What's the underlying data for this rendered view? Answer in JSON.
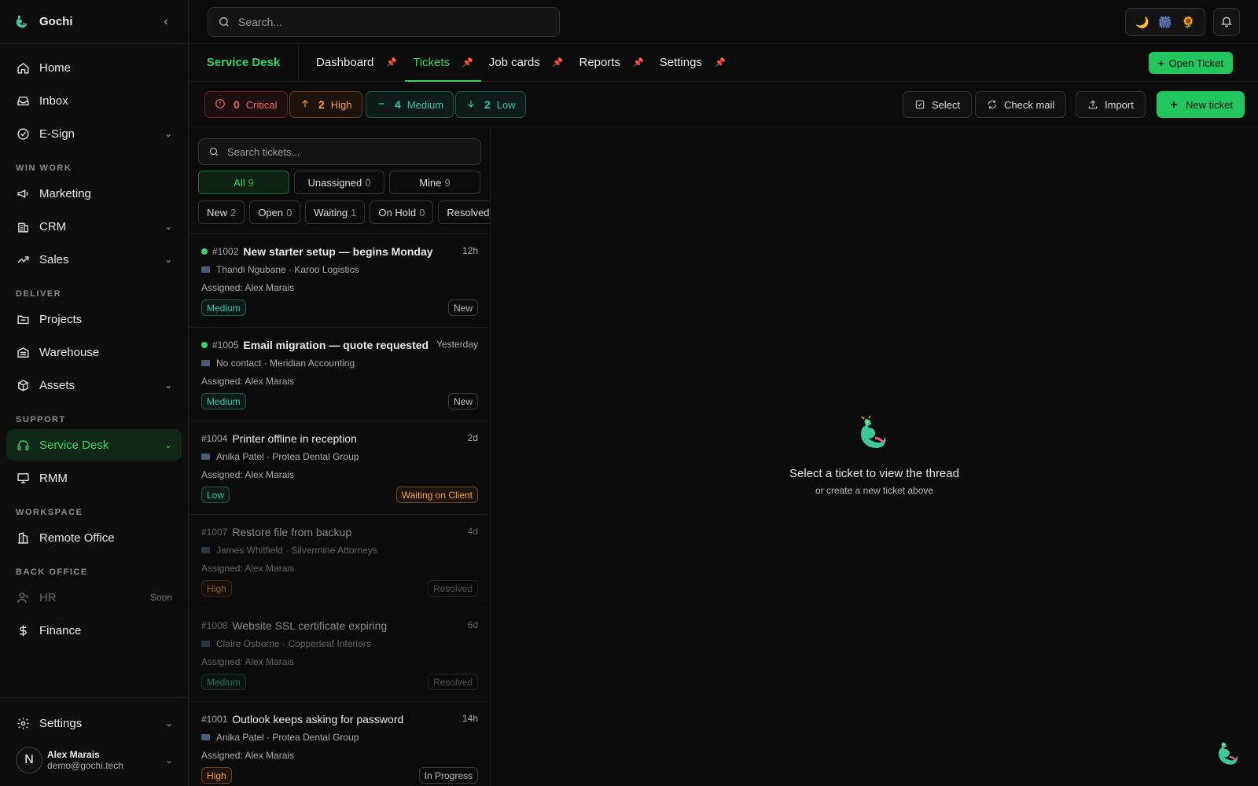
{
  "app": {
    "name": "Gochi",
    "collapse_icon": "chevron-left-icon"
  },
  "sidebar": {
    "top_items": [
      {
        "label": "Home",
        "icon": "home-icon"
      },
      {
        "label": "Inbox",
        "icon": "inbox-icon"
      },
      {
        "label": "E-Sign",
        "icon": "check-circle-icon",
        "expandable": true
      }
    ],
    "sections": [
      {
        "title": "WIN WORK",
        "items": [
          {
            "label": "Marketing",
            "icon": "megaphone-icon"
          },
          {
            "label": "CRM",
            "icon": "building-icon",
            "expandable": true
          },
          {
            "label": "Sales",
            "icon": "trending-up-icon",
            "expandable": true
          }
        ]
      },
      {
        "title": "DELIVER",
        "items": [
          {
            "label": "Projects",
            "icon": "folder-icon"
          },
          {
            "label": "Warehouse",
            "icon": "warehouse-icon"
          },
          {
            "label": "Assets",
            "icon": "box-icon",
            "expandable": true
          }
        ]
      },
      {
        "title": "SUPPORT",
        "items": [
          {
            "label": "Service Desk",
            "icon": "headset-icon",
            "expandable": true,
            "active": true
          },
          {
            "label": "RMM",
            "icon": "monitor-icon"
          }
        ]
      },
      {
        "title": "WORKSPACE",
        "items": [
          {
            "label": "Remote Office",
            "icon": "office-icon"
          }
        ]
      },
      {
        "title": "BACK OFFICE",
        "items": [
          {
            "label": "HR",
            "icon": "user-icon",
            "disabled": true,
            "badge": "Soon"
          },
          {
            "label": "Finance",
            "icon": "dollar-icon"
          }
        ]
      }
    ],
    "settings_label": "Settings",
    "user": {
      "initial": "N",
      "name": "Alex Marais",
      "email": "demo@gochi.tech"
    }
  },
  "topbar": {
    "search_placeholder": "Search...",
    "theme_icons": [
      "🌙",
      "🎆",
      "🌻"
    ]
  },
  "tabbar": {
    "module": "Service Desk",
    "tabs": [
      {
        "label": "Dashboard",
        "active": false
      },
      {
        "label": "Tickets",
        "active": true
      },
      {
        "label": "Job cards",
        "active": false
      },
      {
        "label": "Reports",
        "active": false
      },
      {
        "label": "Settings",
        "active": false
      }
    ],
    "open_ticket_label": "Open Ticket"
  },
  "priority": {
    "critical": {
      "count": "0",
      "label": "Critical"
    },
    "high": {
      "count": "2",
      "label": "High"
    },
    "medium": {
      "count": "4",
      "label": "Medium"
    },
    "low": {
      "count": "2",
      "label": "Low"
    }
  },
  "actions": {
    "select": "Select",
    "check_mail": "Check mail",
    "import": "Import",
    "new_ticket": "New ticket"
  },
  "list": {
    "search_placeholder": "Search tickets...",
    "segments": [
      {
        "label": "All",
        "count": "9"
      },
      {
        "label": "Unassigned",
        "count": "0"
      },
      {
        "label": "Mine",
        "count": "9"
      }
    ],
    "filters": [
      {
        "label": "New",
        "count": "2"
      },
      {
        "label": "Open",
        "count": "0"
      },
      {
        "label": "Waiting",
        "count": "1"
      },
      {
        "label": "On Hold",
        "count": "0"
      },
      {
        "label": "Resolved",
        "count": "2"
      }
    ],
    "tickets": [
      {
        "id": "#1002",
        "title": "New starter setup — begins Monday",
        "age": "12h",
        "contact": "Thandi Ngubane",
        "company": "Karoo Logistics",
        "assigned": "Assigned: Alex Marais",
        "priority": "Medium",
        "status": "New",
        "unread": true,
        "dim": false
      },
      {
        "id": "#1005",
        "title": "Email migration — quote requested",
        "age": "Yesterday",
        "contact": "No contact",
        "company": "Meridian Accounting",
        "assigned": "Assigned: Alex Marais",
        "priority": "Medium",
        "status": "New",
        "unread": true,
        "dim": false
      },
      {
        "id": "#1004",
        "title": "Printer offline in reception",
        "age": "2d",
        "contact": "Anika Patel",
        "company": "Protea Dental Group",
        "assigned": "Assigned: Alex Marais",
        "priority": "Low",
        "status": "Waiting on Client",
        "unread": false,
        "dim": false
      },
      {
        "id": "#1007",
        "title": "Restore file from backup",
        "age": "4d",
        "contact": "James Whitfield",
        "company": "Silvermine Attorneys",
        "assigned": "Assigned: Alex Marais",
        "priority": "High",
        "status": "Resolved",
        "unread": false,
        "dim": true
      },
      {
        "id": "#1008",
        "title": "Website SSL certificate expiring",
        "age": "6d",
        "contact": "Claire Osborne",
        "company": "Copperleaf Interiors",
        "assigned": "Assigned: Alex Marais",
        "priority": "Medium",
        "status": "Resolved",
        "unread": false,
        "dim": true
      },
      {
        "id": "#1001",
        "title": "Outlook keeps asking for password",
        "age": "14h",
        "contact": "Anika Patel",
        "company": "Protea Dental Group",
        "assigned": "Assigned: Alex Marais",
        "priority": "High",
        "status": "In Progress",
        "unread": false,
        "dim": false
      }
    ]
  },
  "empty_state": {
    "title": "Select a ticket to view the thread",
    "subtitle": "or create a new ticket above"
  },
  "colors": {
    "accent": "#35d46a",
    "button_green": "#22c55e",
    "critical": "#f06565",
    "high": "#f39c4d",
    "medium": "#36c5a5"
  }
}
